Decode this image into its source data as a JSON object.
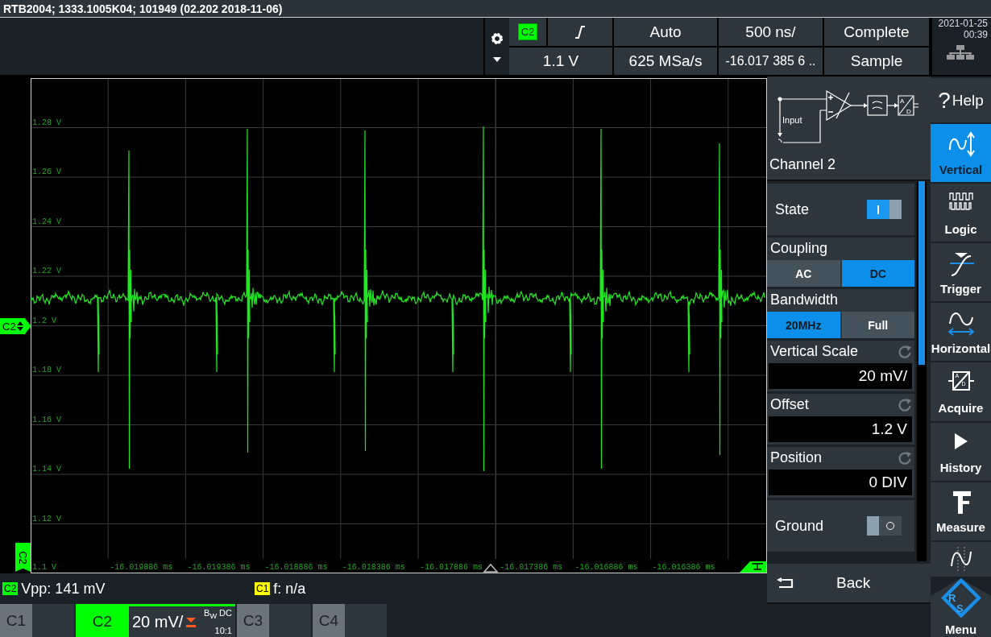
{
  "title_bar": {
    "title": "RTB2004; 1333.1005K04; 101949 (02.202 2018-11-06)"
  },
  "top_bar": {
    "trigger_source": "C2",
    "trigger_mode": "Auto",
    "time_scale": "500 ns/",
    "acquisition_state": "Complete",
    "trigger_level": "1.1 V",
    "sample_rate": "625 MSa/s",
    "time_position": "-16.017 385 6 ..",
    "acquisition_mode": "Sample",
    "date": "2021-01-25",
    "time": "00:39"
  },
  "plot": {
    "y_labels": [
      "1.28 V",
      "1.26 V",
      "1.24 V",
      "1.22 V",
      "1.2 V",
      "1.18 V",
      "1.16 V",
      "1.14 V",
      "1.12 V",
      "1.1 V"
    ],
    "x_labels": [
      "-16.019886 ms",
      "-16.019386 ms",
      "-16.018886 ms",
      "-16.018386 ms",
      "-16.017886 ms",
      "-16.017386 ms",
      "-16.016886 ms",
      "-16.016386 ms"
    ],
    "level_marker": "C2",
    "trigger_marker": "C2"
  },
  "side_panel": {
    "diagram_label": "Input",
    "converter_letters": [
      "A",
      "D"
    ],
    "title": "Channel 2",
    "settings": [
      {
        "kind": "toggle",
        "label": "State",
        "on": true
      },
      {
        "kind": "choice",
        "label": "Coupling",
        "options": [
          {
            "label": "AC",
            "selected": false
          },
          {
            "label": "DC",
            "selected": true
          }
        ]
      },
      {
        "kind": "choice",
        "label": "Bandwidth",
        "options": [
          {
            "label": "20MHz",
            "selected": true
          },
          {
            "label": "Full",
            "selected": false
          }
        ]
      },
      {
        "kind": "value",
        "label": "Vertical Scale",
        "value": "20 mV/"
      },
      {
        "kind": "value",
        "label": "Offset",
        "value": "1.2 V"
      },
      {
        "kind": "value",
        "label": "Position",
        "value": "0 DIV"
      },
      {
        "kind": "toggle",
        "label": "Ground",
        "on": false
      }
    ],
    "back": "Back"
  },
  "nav": [
    {
      "glyph": "?",
      "label": "Help",
      "selected": false
    },
    {
      "label": "Vertical",
      "selected": true
    },
    {
      "label": "Logic",
      "selected": false
    },
    {
      "label": "Trigger",
      "selected": false
    },
    {
      "label": "Horizontal",
      "selected": false
    },
    {
      "label": "Acquire",
      "icon_letters": [
        "A",
        "D"
      ],
      "selected": false
    },
    {
      "label": "History",
      "selected": false
    },
    {
      "label": "Measure",
      "selected": false
    },
    {
      "selected": false
    },
    {
      "label": "Menu",
      "logo_letters": [
        "R",
        "S"
      ],
      "selected": false
    }
  ],
  "measurements": [
    {
      "source": "C2",
      "color": "#00ff00",
      "text": "Vpp: 141 mV"
    },
    {
      "source": "C1",
      "color": "#ffff00",
      "text": "f: n/a"
    }
  ],
  "channels": [
    {
      "label": "C1",
      "selected": false
    },
    {
      "label": "C2",
      "selected": true,
      "scale": "20 mV/",
      "bandwidth": "B$_{W}$ DC",
      "probe": "10:1"
    },
    {
      "label": "C3",
      "selected": false
    },
    {
      "label": "C4",
      "selected": false
    }
  ]
}
